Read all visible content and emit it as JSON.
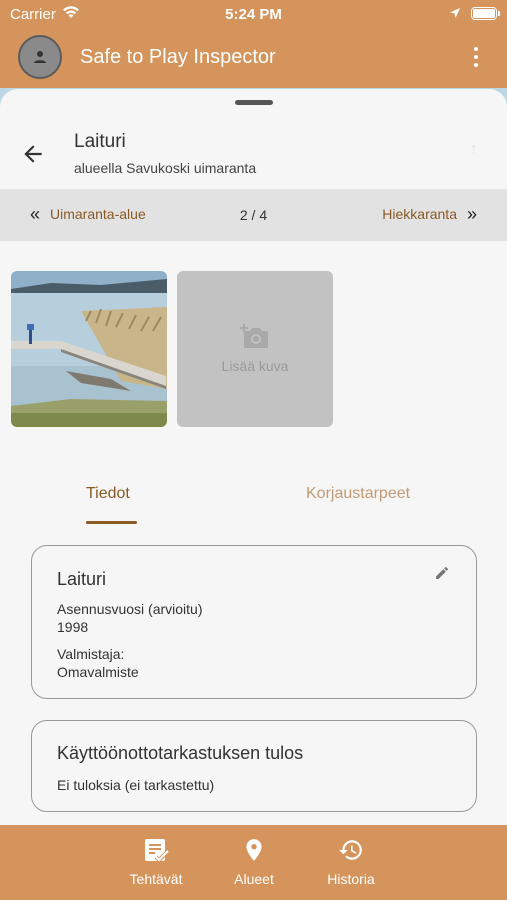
{
  "status_bar": {
    "carrier": "Carrier",
    "time": "5:24 PM"
  },
  "app_bar": {
    "title": "Safe to Play Inspector",
    "avatar_icon": "person-icon",
    "menu_icon": "more-vert-icon"
  },
  "header": {
    "title": "Laituri",
    "subtitle": "alueella Savukoski uimaranta"
  },
  "navigator": {
    "prev_label": "Uimaranta-alue",
    "position": "2 / 4",
    "next_label": "Hiekkaranta"
  },
  "photos": {
    "add_label": "Lisää kuva"
  },
  "tabs": [
    {
      "label": "Tiedot",
      "active": true
    },
    {
      "label": "Korjaustarpeet",
      "active": false
    }
  ],
  "details_card": {
    "title": "Laituri",
    "install_year_label": "Asennusvuosi (arvioitu)",
    "install_year_value": "1998",
    "manufacturer_label": "Valmistaja:",
    "manufacturer_value": "Omavalmiste"
  },
  "inspection_card": {
    "title": "Käyttöönottotarkastuksen tulos",
    "result": "Ei tuloksia (ei tarkastettu)"
  },
  "bottom_nav": [
    {
      "label": "Tehtävät",
      "icon": "task-list-icon"
    },
    {
      "label": "Alueet",
      "icon": "location-pin-icon"
    },
    {
      "label": "Historia",
      "icon": "history-icon"
    }
  ],
  "colors": {
    "brand": "#d4945c",
    "accent": "#8a5a25",
    "strip": "#e2e2e2"
  }
}
